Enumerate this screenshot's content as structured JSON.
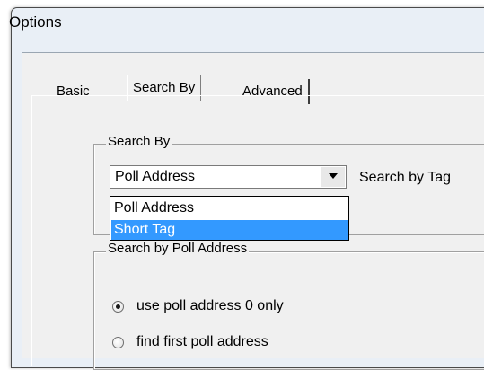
{
  "window": {
    "title": "Options"
  },
  "tabs": [
    {
      "label": "Basic"
    },
    {
      "label": "Search By"
    },
    {
      "label": "Advanced"
    }
  ],
  "search_by_group": {
    "label": "Search By",
    "combo_value": "Poll Address",
    "search_by_tag_label": "Search by Tag",
    "dropdown_options": [
      "Poll Address",
      "Short Tag"
    ],
    "highlighted_option": "Short Tag"
  },
  "poll_address_group": {
    "label": "Search by Poll Address",
    "options": [
      {
        "label": "use poll address 0 only",
        "selected": true
      },
      {
        "label": "find first poll address",
        "selected": false
      }
    ]
  }
}
